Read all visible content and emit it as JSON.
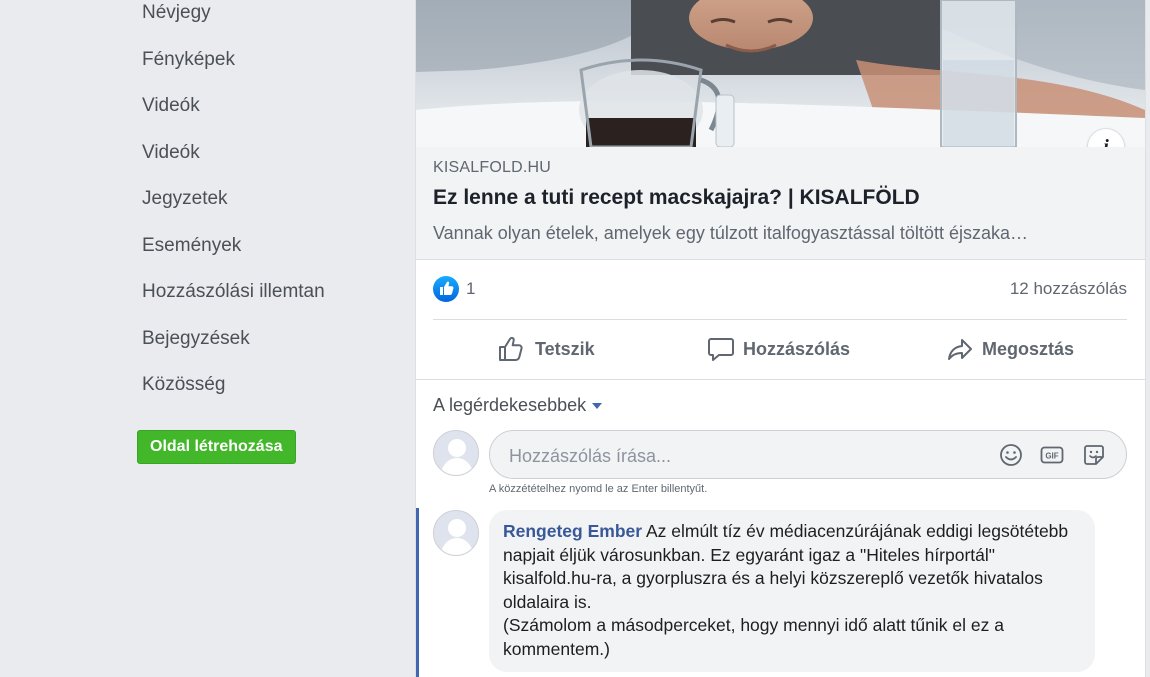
{
  "left_nav": {
    "items": [
      {
        "label": "Névjegy"
      },
      {
        "label": "Fényképek"
      },
      {
        "label": "Videók"
      },
      {
        "label": "Videók"
      },
      {
        "label": "Jegyzetek"
      },
      {
        "label": "Események"
      },
      {
        "label": "Hozzászólási illemtan"
      },
      {
        "label": "Bejegyzések"
      },
      {
        "label": "Közösség"
      }
    ],
    "create_page_button": "Oldal létrehozása"
  },
  "post": {
    "link": {
      "domain": "KISALFOLD.HU",
      "title": "Ez lenne a tuti recept macskajajra? | KISALFÖLD",
      "description": "Vannak olyan ételek, amelyek egy túlzott italfogyasztással töltött éjszaka…",
      "info_icon": "i"
    },
    "reactions": {
      "icon": "like-icon",
      "count": "1",
      "comments_count": "12 hozzászólás"
    },
    "actions": {
      "like": "Tetszik",
      "comment": "Hozzászólás",
      "share": "Megosztás"
    },
    "comments": {
      "sort_label": "A legérdekesebbek",
      "input_placeholder": "Hozzászólás írása...",
      "enter_hint": "A közzétételhez nyomd le az Enter billentyűt.",
      "items": [
        {
          "author": "Rengeteg Ember",
          "text": " Az elmúlt tíz év médiacenzúrájának eddigi legsötétebb napjait éljük városunkban. Ez egyaránt igaz a \"Hiteles hírportál\" kisalfold.hu-ra, a gyorpluszra és a helyi közszereplő vezetők hivatalos oldalaira is.\n(Számolom a másodperceket, hogy mennyi idő alatt tűnik el ez a kommentem.)"
        }
      ]
    }
  },
  "colors": {
    "accent": "#4267b2",
    "create_button": "#42b72a",
    "author_link": "#385898",
    "page_background": "#e9ebee"
  }
}
